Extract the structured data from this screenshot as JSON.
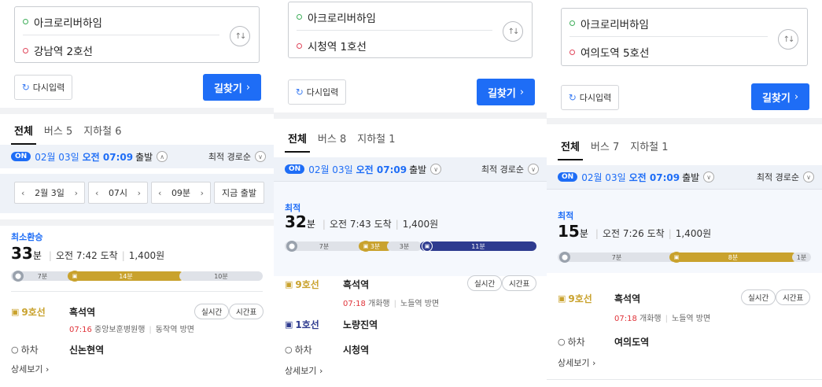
{
  "panels": [
    {
      "origin": "아크로리버하임",
      "destination": "강남역 2호선",
      "reset_label": "다시입력",
      "find_label": "길찾기",
      "tabs": [
        {
          "label": "전체"
        },
        {
          "label": "버스 5"
        },
        {
          "label": "지하철 6"
        }
      ],
      "on_label": "ON",
      "date": "02월 03일",
      "time": "오전 07:09",
      "depart": "출발",
      "sort": "최적 경로순",
      "picker": {
        "date": "2월 3일",
        "hour": "07시",
        "minute": "09분",
        "now": "지금 출발"
      },
      "route": {
        "title": "최소환승",
        "minutes": "33",
        "unit": "분",
        "arrival": "오전 7:42 도착",
        "fare": "1,400원",
        "segments": [
          {
            "kind": "walk",
            "label": "7분"
          },
          {
            "kind": "l9",
            "label": "14분"
          },
          {
            "kind": "walk",
            "label": "10분"
          }
        ],
        "legs": [
          {
            "line": "9호선",
            "station": "흑석역",
            "time": "07:16",
            "direction": "중앙보훈병원행",
            "exit": "동작역 방면",
            "realtime": "실시간",
            "timetable": "시간표"
          },
          {
            "line": "하차",
            "station": "신논현역"
          }
        ],
        "detail": "상세보기"
      }
    },
    {
      "origin": "아크로리버하임",
      "destination": "시청역 1호선",
      "reset_label": "다시입력",
      "find_label": "길찾기",
      "tabs": [
        {
          "label": "전체"
        },
        {
          "label": "버스 8"
        },
        {
          "label": "지하철 1"
        }
      ],
      "on_label": "ON",
      "date": "02월 03일",
      "time": "오전 07:09",
      "depart": "출발",
      "sort": "최적 경로순",
      "route": {
        "title": "최적",
        "minutes": "32",
        "unit": "분",
        "arrival": "오전 7:43 도착",
        "fare": "1,400원",
        "segments": [
          {
            "kind": "walk",
            "label": "7분"
          },
          {
            "kind": "l9",
            "label": "3분"
          },
          {
            "kind": "walk",
            "label": "3분"
          },
          {
            "kind": "l1",
            "label": "11분"
          }
        ],
        "legs": [
          {
            "line": "9호선",
            "station": "흑석역",
            "time": "07:18",
            "direction": "개화행",
            "exit": "노들역 방면",
            "realtime": "실시간",
            "timetable": "시간표"
          },
          {
            "line": "1호선",
            "station": "노량진역"
          },
          {
            "line": "하차",
            "station": "시청역"
          }
        ],
        "detail": "상세보기"
      }
    },
    {
      "origin": "아크로리버하임",
      "destination": "여의도역 5호선",
      "reset_label": "다시입력",
      "find_label": "길찾기",
      "tabs": [
        {
          "label": "전체"
        },
        {
          "label": "버스 7"
        },
        {
          "label": "지하철 1"
        }
      ],
      "on_label": "ON",
      "date": "02월 03일",
      "time": "오전 07:09",
      "depart": "출발",
      "sort": "최적 경로순",
      "route": {
        "title": "최적",
        "minutes": "15",
        "unit": "분",
        "arrival": "오전 7:26 도착",
        "fare": "1,400원",
        "segments": [
          {
            "kind": "walk",
            "label": "7분"
          },
          {
            "kind": "l9",
            "label": "8분"
          },
          {
            "kind": "walk",
            "label": "1분"
          }
        ],
        "legs": [
          {
            "line": "9호선",
            "station": "흑석역",
            "time": "07:18",
            "direction": "개화행",
            "exit": "노들역 방면",
            "realtime": "실시간",
            "timetable": "시간표"
          },
          {
            "line": "하차",
            "station": "여의도역"
          }
        ],
        "detail": "상세보기"
      }
    }
  ]
}
